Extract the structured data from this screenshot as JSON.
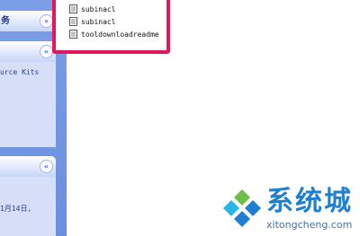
{
  "taskpane": {
    "panels": [
      {
        "header": "务",
        "collapse_glyph": "»",
        "body_lines": []
      },
      {
        "header": "",
        "collapse_glyph": "«",
        "body_lines": [
          "urce Kits"
        ]
      },
      {
        "header": "",
        "collapse_glyph": "«",
        "body_lines": [
          "1月14日,"
        ]
      }
    ]
  },
  "file_list": [
    {
      "name": "subinacl",
      "icon": "file-icon"
    },
    {
      "name": "subinacl",
      "icon": "file-icon"
    },
    {
      "name": "tooldownloadreadme",
      "icon": "file-icon"
    }
  ],
  "watermark": {
    "brand": "系统城",
    "domain": "xitongcheng.com",
    "colors": {
      "blue": "#1f7fd1",
      "cyan": "#28b6e8",
      "green": "#6cc04a"
    }
  },
  "colors": {
    "highlight_border": "#e2185f",
    "taskpane_bg": "#7b9ee6",
    "panel_body": "#d6dff7"
  }
}
